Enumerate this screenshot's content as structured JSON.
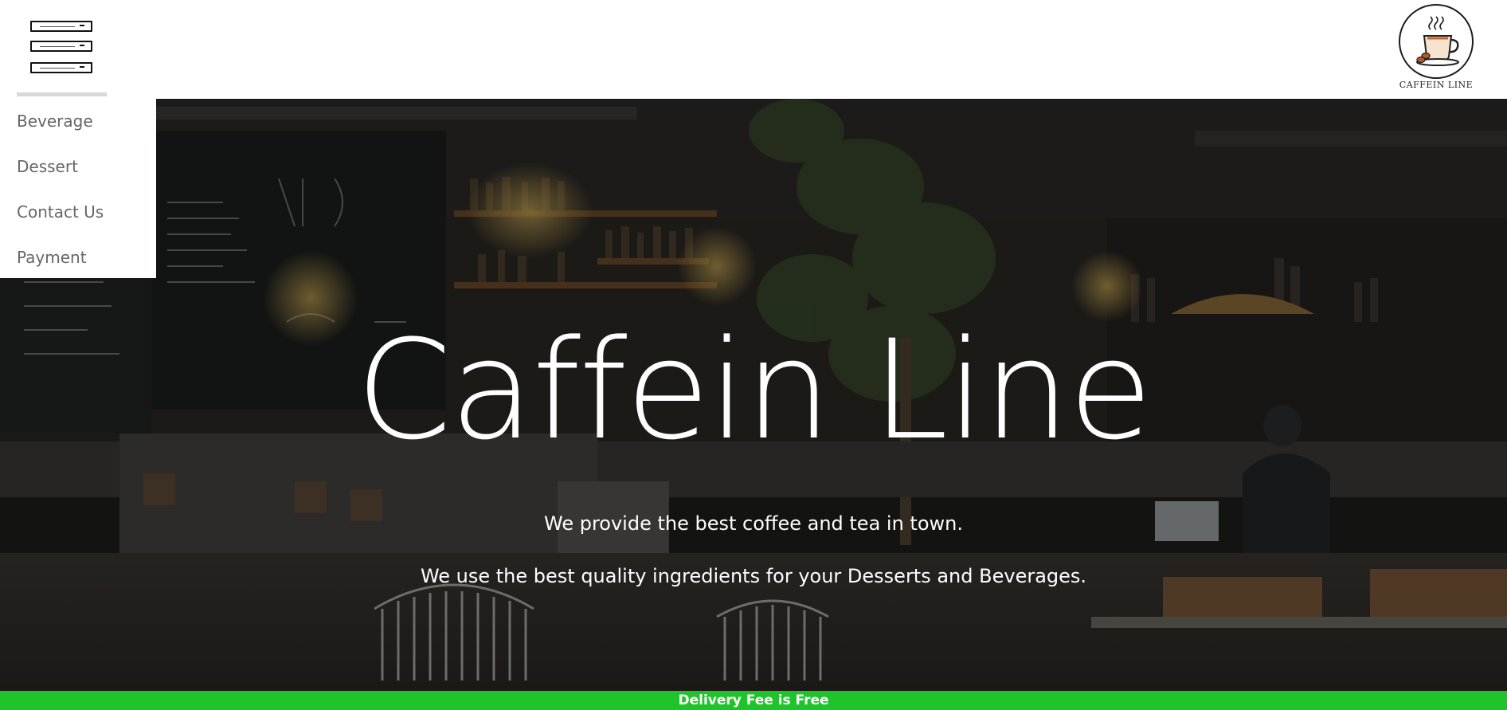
{
  "header": {
    "logo_text": "CAFFEIN LINE"
  },
  "menu": {
    "items": [
      {
        "label": "Beverage"
      },
      {
        "label": "Dessert"
      },
      {
        "label": "Contact Us"
      },
      {
        "label": "Payment"
      }
    ]
  },
  "hero": {
    "title": "Caffein Line",
    "line1": "We provide the best coffee and tea in town.",
    "line2": "We use the best quality ingredients for your Desserts and Beverages."
  },
  "banner": {
    "text": "Delivery Fee is Free",
    "color": "#1fc42a"
  },
  "icons": {
    "menu": "hamburger-menu-icon",
    "logo": "coffee-cup-icon"
  }
}
